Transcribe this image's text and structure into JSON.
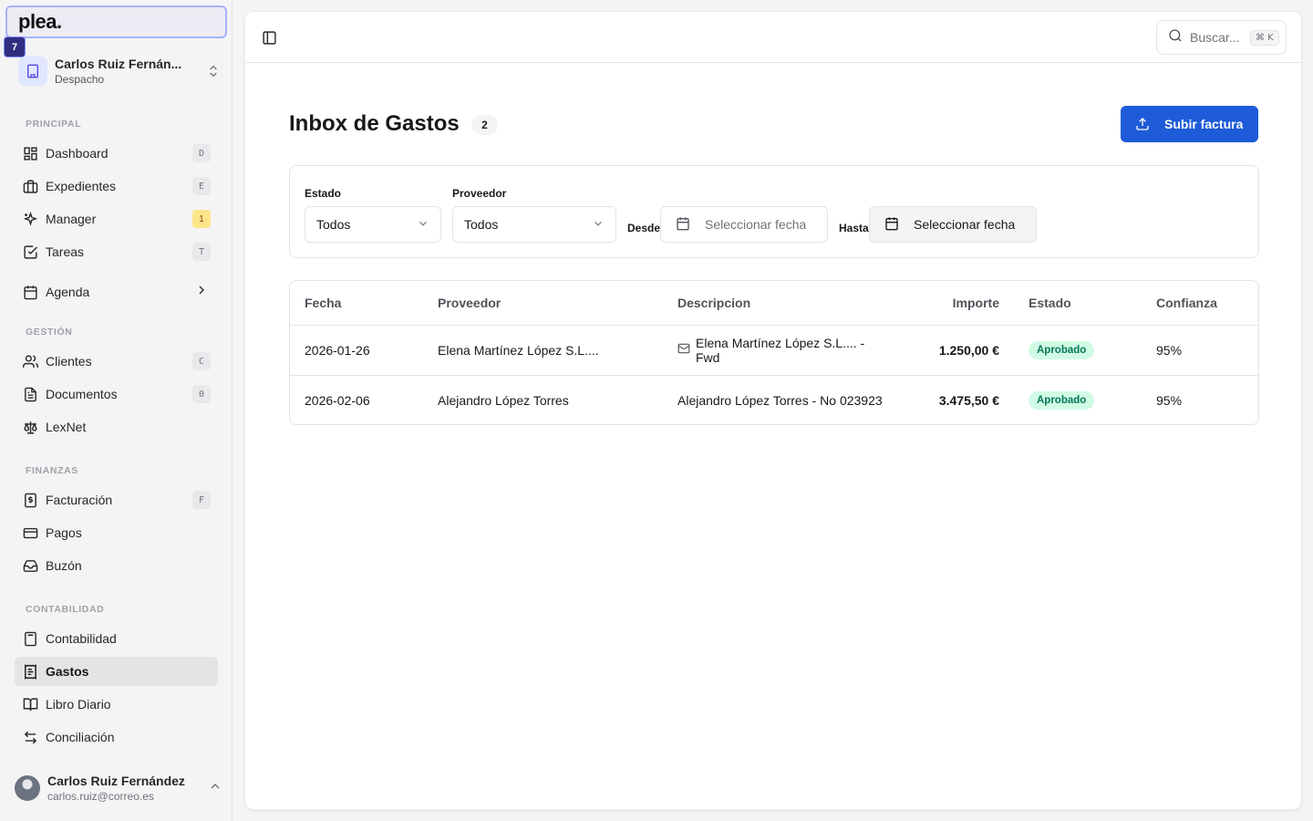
{
  "brand": {
    "logo": "plea.",
    "notification_count": "7"
  },
  "org": {
    "name": "Carlos Ruiz Fernán...",
    "subtitle": "Despacho"
  },
  "sections": {
    "principal": "PRINCIPAL",
    "gestion": "GESTIÓN",
    "finanzas": "FINANZAS",
    "contabilidad": "CONTABILIDAD"
  },
  "nav": {
    "dashboard": {
      "label": "Dashboard",
      "key": "D"
    },
    "expedientes": {
      "label": "Expedientes",
      "key": "E"
    },
    "manager": {
      "label": "Manager",
      "key": "1"
    },
    "tareas": {
      "label": "Tareas",
      "key": "T"
    },
    "agenda": {
      "label": "Agenda"
    },
    "clientes": {
      "label": "Clientes",
      "key": "C"
    },
    "documentos": {
      "label": "Documentos",
      "key": "0"
    },
    "lexnet": {
      "label": "LexNet"
    },
    "facturacion": {
      "label": "Facturación",
      "key": "F"
    },
    "pagos": {
      "label": "Pagos"
    },
    "buzon": {
      "label": "Buzón"
    },
    "contabilidad": {
      "label": "Contabilidad"
    },
    "gastos": {
      "label": "Gastos"
    },
    "libro_diario": {
      "label": "Libro Diario"
    },
    "conciliacion": {
      "label": "Conciliación"
    }
  },
  "user": {
    "name": "Carlos Ruiz Fernández",
    "email": "carlos.ruiz@correo.es"
  },
  "search": {
    "placeholder": "Buscar...",
    "shortcut": "⌘ K"
  },
  "page": {
    "title": "Inbox de Gastos",
    "count": "2",
    "upload_label": "Subir factura"
  },
  "filters": {
    "estado_label": "Estado",
    "estado_value": "Todos",
    "proveedor_label": "Proveedor",
    "proveedor_value": "Todos",
    "desde_label": "Desde",
    "desde_value": "Seleccionar fecha",
    "hasta_label": "Hasta",
    "hasta_value": "Seleccionar fecha"
  },
  "table": {
    "headers": [
      "Fecha",
      "Proveedor",
      "Descripcion",
      "Importe",
      "Estado",
      "Confianza"
    ],
    "rows": [
      {
        "fecha": "2026-01-26",
        "proveedor": "Elena Martínez López S.L....",
        "descripcion": "Elena Martínez López S.L.... - Fwd",
        "importe": "1.250,00 €",
        "estado": "Aprobado",
        "confianza": "95%",
        "email_icon": true
      },
      {
        "fecha": "2026-02-06",
        "proveedor": "Alejandro López Torres",
        "descripcion": "Alejandro López Torres - No 023923",
        "importe": "3.475,50 €",
        "estado": "Aprobado",
        "confianza": "95%",
        "email_icon": false
      }
    ]
  },
  "colors": {
    "accent": "#1d5bd8",
    "status_bg": "#d1fae5",
    "status_text": "#047857"
  }
}
